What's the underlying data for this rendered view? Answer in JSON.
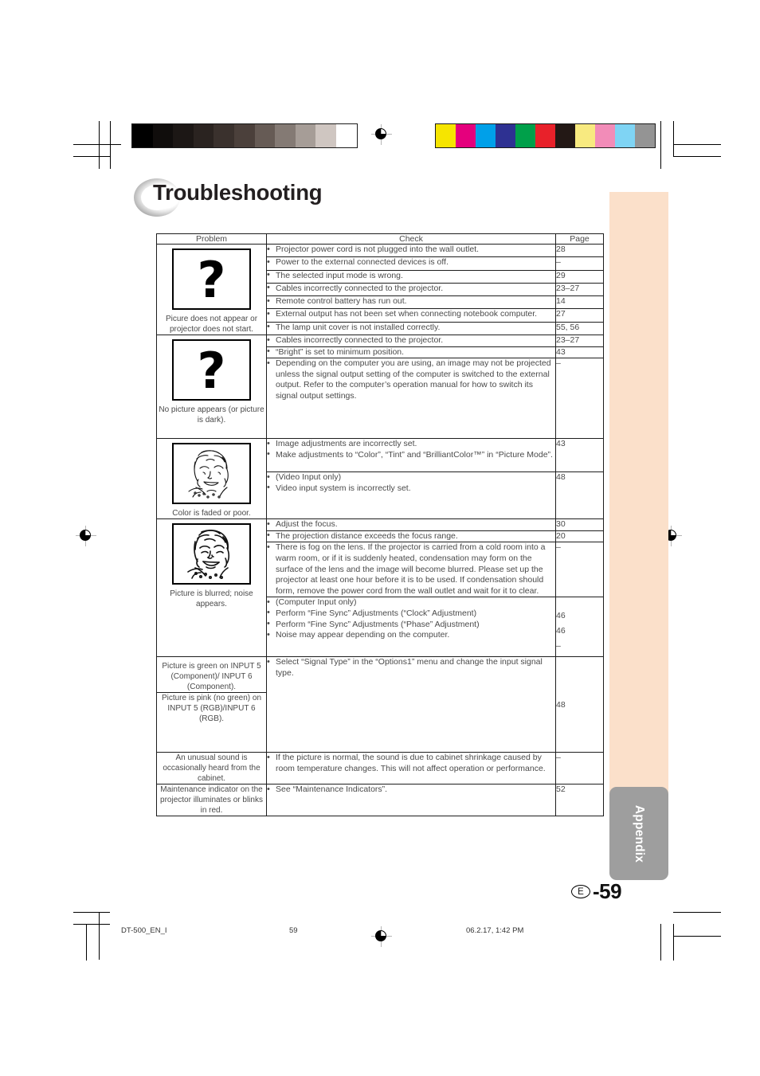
{
  "page": {
    "title": "Troubleshooting",
    "page_label": "59",
    "page_region_code": "E",
    "page_prefix": "-",
    "side_tab_label": "Appendix",
    "colors": {
      "side_tab_bg": "#fbe0ca",
      "side_tab_label_bg": "#9e9e9e",
      "title": "#231f20",
      "table_border": "#1d1d1d",
      "text": "#4a4a4a"
    }
  },
  "footer": {
    "file_name": "DT-500_EN_I",
    "page_number": "59",
    "timestamp": "06.2.17, 1:42 PM"
  },
  "print_marks": {
    "grayscale_wedge": [
      "#000000",
      "#100d0c",
      "#1c1715",
      "#2a2320",
      "#3a312d",
      "#4b403b",
      "#665b55",
      "#847a74",
      "#a69d97",
      "#cfc6c1",
      "#ffffff"
    ],
    "color_bar": [
      "#f6e500",
      "#e5007d",
      "#00a0e9",
      "#2e3192",
      "#00a04a",
      "#e8212a",
      "#231815",
      "#f8ea80",
      "#f28cb8",
      "#7fd4f4",
      "#949494"
    ]
  },
  "table": {
    "headers": [
      "Problem",
      "Check",
      "Page"
    ],
    "sections": [
      {
        "icon": "question-mark",
        "problem": "Picure does not appear or projector does not start.",
        "rows": [
          {
            "items": [
              {
                "text": "Projector power cord is not plugged into the wall outlet.",
                "bullet": true
              }
            ],
            "page": "28"
          },
          {
            "items": [
              {
                "text": "Power to the external connected devices is off.",
                "bullet": true
              }
            ],
            "page": "–"
          },
          {
            "items": [
              {
                "text": "The selected input mode is wrong.",
                "bullet": true
              }
            ],
            "page": "29"
          },
          {
            "items": [
              {
                "text": "Cables incorrectly connected to the projector.",
                "bullet": true
              }
            ],
            "page": "23–27"
          },
          {
            "items": [
              {
                "text": "Remote control battery has run out.",
                "bullet": true
              }
            ],
            "page": "14"
          },
          {
            "items": [
              {
                "text": "External output has not been set when connecting notebook computer.",
                "bullet": true
              }
            ],
            "page": "27"
          },
          {
            "items": [
              {
                "text": "The lamp unit cover is not installed correctly.",
                "bullet": true
              }
            ],
            "page": "55, 56"
          }
        ]
      },
      {
        "icon": "question-mark",
        "problem": "No picture appears (or picture is dark).",
        "rows": [
          {
            "items": [
              {
                "text": "Cables incorrectly connected to the projector.",
                "bullet": true
              }
            ],
            "page": "23–27"
          },
          {
            "items": [
              {
                "text": "“Bright” is set to minimum position.",
                "bullet": true
              }
            ],
            "page": "43"
          },
          {
            "items": [
              {
                "text": "Depending on the computer you are using, an image may not be projected unless the signal output setting of the computer is switched to the external output. Refer to the computer’s operation manual for how to switch its signal output settings.",
                "bullet": true
              }
            ],
            "page": "–"
          }
        ]
      },
      {
        "icon": "face-faded-color",
        "problem": "Color is faded or poor.",
        "rows": [
          {
            "items": [
              {
                "text": "Image adjustments are incorrectly set.",
                "bullet": true
              },
              {
                "text": "Make adjustments to “Color”, “Tint” and “BrilliantColor™” in “Picture Mode”.",
                "bullet": true
              }
            ],
            "page": "43"
          },
          {
            "items": [
              {
                "text": "(Video Input only)",
                "bullet": false
              },
              {
                "text": "Video input system is incorrectly set.",
                "bullet": true
              }
            ],
            "page": "48"
          }
        ]
      },
      {
        "icon": "face-blurred",
        "problem": "Picture is blurred; noise appears.",
        "rows": [
          {
            "items": [
              {
                "text": "Adjust the focus.",
                "bullet": true
              }
            ],
            "page": "30"
          },
          {
            "items": [
              {
                "text": "The projection distance exceeds the focus range.",
                "bullet": true
              }
            ],
            "page": "20"
          },
          {
            "items": [
              {
                "text": "There is fog on the lens. If the projector is carried from a cold room into a warm room, or if it is suddenly heated, condensation may form on the surface of the lens and the image will become blurred. Please set up the projector at least one hour before it is to be used. If condensation should form, remove the power cord from the wall outlet and wait for it to clear.",
                "bullet": true
              }
            ],
            "page": "–"
          },
          {
            "items": [
              {
                "text": "(Computer Input only)",
                "bullet": false
              },
              {
                "text": "Perform “Fine Sync” Adjustments (“Clock” Adjustment)",
                "bullet": true
              },
              {
                "text": "Perform “Fine Sync” Adjustments (“Phase” Adjustment)",
                "bullet": true
              },
              {
                "text": "Noise may appear depending on the computer.",
                "bullet": true
              }
            ],
            "pages": [
              "46",
              "46",
              "–"
            ]
          }
        ]
      }
    ],
    "tail_rows": [
      {
        "problem": "Picture is green on INPUT 5 (Component)/ INPUT 6 (Component).",
        "check": "Select “Signal Type” in the “Options1” menu and change the input signal type.",
        "page": "48"
      },
      {
        "problem": "Picture is pink (no green) on INPUT 5 (RGB)/INPUT 6 (RGB).",
        "check": "",
        "page": ""
      },
      {
        "problem": "An unusual sound is occasionally heard from the cabinet.",
        "check": "If the picture is normal, the sound is due to cabinet shrinkage caused by room temperature changes. This will not affect operation or performance.",
        "page": "–"
      },
      {
        "problem": "Maintenance indicator on the projector illuminates or blinks in red.",
        "check": "See “Maintenance Indicators”.",
        "page": "52"
      }
    ]
  }
}
